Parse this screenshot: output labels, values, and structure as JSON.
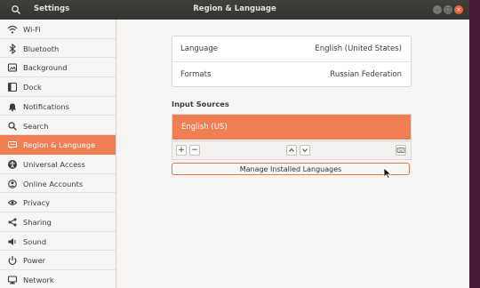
{
  "titlebar": {
    "app_title": "Settings",
    "panel_title": "Region & Language"
  },
  "sidebar": {
    "items": [
      {
        "label": "Wi-Fi",
        "icon": "wifi-icon"
      },
      {
        "label": "Bluetooth",
        "icon": "bluetooth-icon"
      },
      {
        "label": "Background",
        "icon": "background-icon"
      },
      {
        "label": "Dock",
        "icon": "dock-icon"
      },
      {
        "label": "Notifications",
        "icon": "bell-icon"
      },
      {
        "label": "Search",
        "icon": "search-icon"
      },
      {
        "label": "Region & Language",
        "icon": "region-icon",
        "active": true
      },
      {
        "label": "Universal Access",
        "icon": "accessibility-icon"
      },
      {
        "label": "Online Accounts",
        "icon": "online-accounts-icon"
      },
      {
        "label": "Privacy",
        "icon": "privacy-icon"
      },
      {
        "label": "Sharing",
        "icon": "sharing-icon"
      },
      {
        "label": "Sound",
        "icon": "sound-icon"
      },
      {
        "label": "Power",
        "icon": "power-icon"
      },
      {
        "label": "Network",
        "icon": "network-icon"
      }
    ]
  },
  "settings": {
    "language_label": "Language",
    "language_value": "English (United States)",
    "formats_label": "Formats",
    "formats_value": "Russian Federation"
  },
  "input_sources": {
    "title": "Input Sources",
    "selected_source": "English (US)",
    "add_label": "+",
    "remove_label": "−"
  },
  "manage_button_label": "Manage Installed Languages",
  "colors": {
    "accent": "#ef7f53",
    "titlebar": "#3a3935",
    "close": "#e9643b"
  }
}
